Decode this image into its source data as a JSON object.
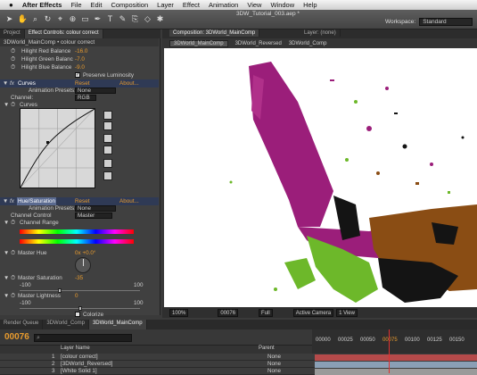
{
  "menubar": {
    "apple": "",
    "items": [
      "After Effects",
      "File",
      "Edit",
      "Composition",
      "Layer",
      "Effect",
      "Animation",
      "View",
      "Window",
      "Help"
    ]
  },
  "toolbar": {
    "doc_title": "3DW_Tutorial_003.aep *",
    "workspace_label": "Workspace:",
    "workspace_value": "Standard"
  },
  "left_panel": {
    "tabs": [
      "Project",
      "Effect Controls: colour correct",
      "Layer: (none)"
    ],
    "header": "3DWorld_MainComp • colour correct",
    "balance": [
      {
        "label": "Hilight Red Balance",
        "value": "-16.0"
      },
      {
        "label": "Hilight Green Balanc",
        "value": "-7.0"
      },
      {
        "label": "Hilight Blue Balance",
        "value": "-9.0"
      }
    ],
    "preserve_luminosity": "Preserve Luminosity",
    "curves": {
      "name": "Curves",
      "reset": "Reset",
      "about": "About...",
      "presets_label": "Animation Presets:",
      "presets_value": "None",
      "channel_label": "Channel:",
      "channel_value": "RGB",
      "curves_label": "Curves"
    },
    "hue_sat": {
      "name": "Hue/Saturation",
      "reset": "Reset",
      "about": "About...",
      "presets_label": "Animation Presets:",
      "presets_value": "None",
      "channel_control_label": "Channel Control",
      "channel_control_value": "Master",
      "channel_range": "Channel Range",
      "master_hue_label": "Master Hue",
      "master_hue_value": "0x +0.0°",
      "master_saturation_label": "Master Saturation",
      "master_saturation_value": "-35",
      "sat_min": "-100",
      "sat_max": "100",
      "master_lightness_label": "Master Lightness",
      "master_lightness_value": "0",
      "light_min": "-100",
      "light_max": "100",
      "colorize": "Colorize"
    }
  },
  "comp": {
    "tab_title": "Composition: 3DWorld_MainComp",
    "layer_tab": "Layer: (none)",
    "subtabs": [
      "3DWorld_MainComp",
      "3DWorld_Reversed",
      "3DWorld_Comp"
    ],
    "viewer_bar": [
      "100%",
      "00076",
      "Full",
      "Active Camera",
      "1 View"
    ]
  },
  "timeline": {
    "tabs": [
      "Render Queue",
      "3DWorld_Comp",
      "3DWorld_MainComp"
    ],
    "timecode": "00076",
    "columns": {
      "layer_name": "Layer Name",
      "parent": "Parent"
    },
    "layers": [
      {
        "num": "1",
        "name": "[colour correct]",
        "parent": "None"
      },
      {
        "num": "2",
        "name": "[3DWorld_Reversed]",
        "parent": "None"
      },
      {
        "num": "3",
        "name": "[White Solid 1]",
        "parent": "None"
      }
    ],
    "ruler": [
      "00000",
      "00025",
      "00050",
      "00075",
      "00100",
      "00125",
      "00150"
    ]
  },
  "colors": {
    "accent": "#e89b2e",
    "magenta": "#9b1e7a",
    "green": "#6db82a",
    "brown": "#8a4d14",
    "black": "#141414"
  }
}
